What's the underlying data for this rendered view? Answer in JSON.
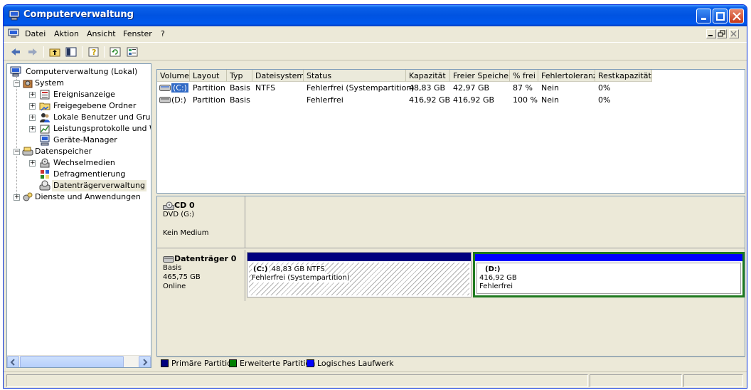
{
  "window": {
    "title": "Computerverwaltung"
  },
  "menu": {
    "items": [
      "Datei",
      "Aktion",
      "Ansicht",
      "Fenster",
      "?"
    ]
  },
  "tree": {
    "root": "Computerverwaltung (Lokal)",
    "items": [
      "System",
      "Ereignisanzeige",
      "Freigegebene Ordner",
      "Lokale Benutzer und Gruppen",
      "Leistungsprotokolle und Warnungen",
      "Geräte-Manager",
      "Datenspeicher",
      "Wechselmedien",
      "Defragmentierung",
      "Datenträgerverwaltung",
      "Dienste und Anwendungen"
    ]
  },
  "volumes": {
    "headers": [
      "Volume",
      "Layout",
      "Typ",
      "Dateisystem",
      "Status",
      "Kapazität",
      "Freier Speicher",
      "% frei",
      "Fehlertoleranz",
      "Restkapazität"
    ],
    "rows": [
      [
        "(C:)",
        "Partition",
        "Basis",
        "NTFS",
        "Fehlerfrei (Systempartition)",
        "48,83 GB",
        "42,97 GB",
        "87 %",
        "Nein",
        "0%"
      ],
      [
        "(D:)",
        "Partition",
        "Basis",
        "",
        "Fehlerfrei",
        "416,92 GB",
        "416,92 GB",
        "100 %",
        "Nein",
        "0%"
      ]
    ]
  },
  "disks": {
    "cd": {
      "name": "CD 0",
      "line1": "DVD (G:)",
      "line2": "Kein Medium"
    },
    "disk0": {
      "name": "Datenträger 0",
      "type": "Basis",
      "size": "465,75 GB",
      "state": "Online",
      "partitions": [
        {
          "label": "(C:)",
          "size": "48,83 GB NTFS",
          "status": "Fehlerfrei (Systempartition)",
          "color": "#00007f"
        },
        {
          "label": "(D:)",
          "size": "416,92 GB",
          "status": "Fehlerfrei",
          "color": "#0000ff"
        }
      ]
    }
  },
  "legend": [
    {
      "label": "Primäre Partition",
      "color": "#00007f"
    },
    {
      "label": "Erweiterte Partition",
      "color": "#008000"
    },
    {
      "label": "Logisches Laufwerk",
      "color": "#0000ff"
    }
  ]
}
